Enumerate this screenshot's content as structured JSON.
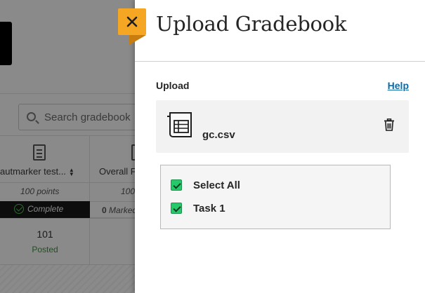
{
  "background": {
    "search_placeholder": "Search gradebook",
    "columns": [
      {
        "title": "autmarker test...",
        "points": "100 points",
        "status": "Complete",
        "score": "101",
        "score_status": "Posted"
      },
      {
        "title": "Overall F",
        "points": "100",
        "marked_count": "0",
        "marked_label": "Marked"
      }
    ]
  },
  "panel": {
    "title": "Upload Gradebook",
    "upload_label": "Upload",
    "help_label": "Help",
    "file": {
      "name": "gc.csv",
      "icon": "spreadsheet-file-icon"
    },
    "options": [
      {
        "label": "Select All",
        "checked": true
      },
      {
        "label": "Task 1",
        "checked": true
      }
    ]
  },
  "colors": {
    "close_accent": "#f5a623",
    "checkbox_green": "#26c96a",
    "link_blue": "#0b6aa8",
    "posted_green": "#244d24"
  }
}
